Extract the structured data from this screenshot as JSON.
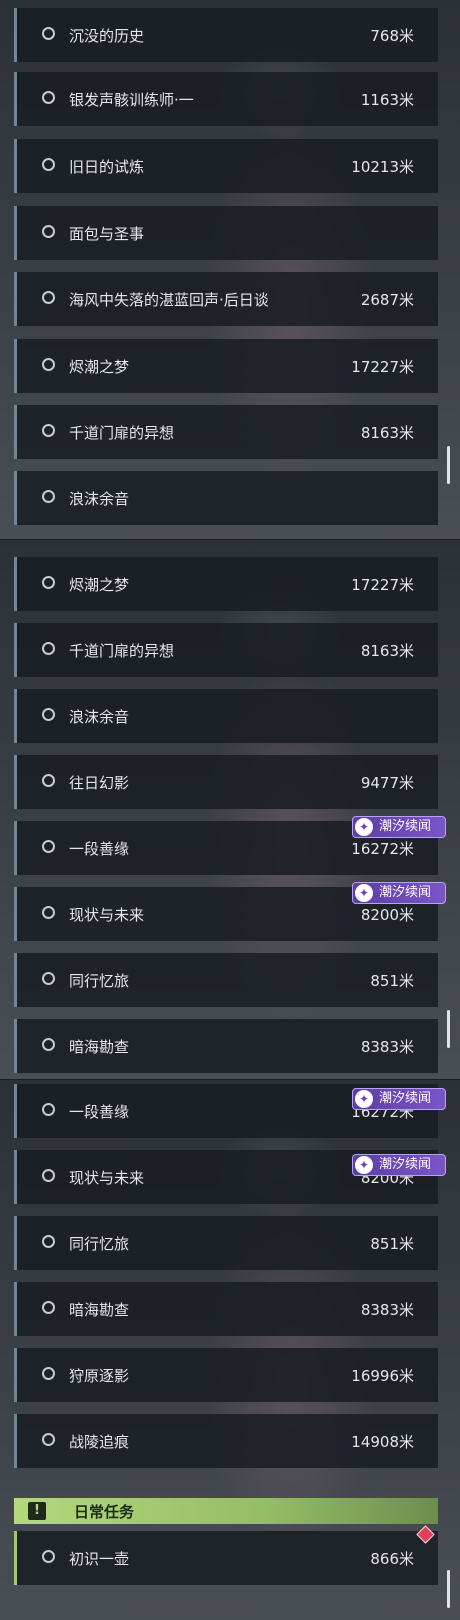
{
  "panel1": {
    "rows": [
      {
        "name": "沉没的历史",
        "distance": "768米"
      },
      {
        "name": "银发声骸训练师·一",
        "distance": "1163米"
      },
      {
        "name": "旧日的试炼",
        "distance": "10213米"
      },
      {
        "name": "面包与圣事",
        "distance": ""
      },
      {
        "name": "海风中失落的湛蓝回声·后日谈",
        "distance": "2687米"
      },
      {
        "name": "烬潮之梦",
        "distance": "17227米"
      },
      {
        "name": "千道门扉的异想",
        "distance": "8163米"
      },
      {
        "name": "浪沫余音",
        "distance": ""
      }
    ]
  },
  "panel2": {
    "rows": [
      {
        "name": "烬潮之梦",
        "distance": "17227米"
      },
      {
        "name": "千道门扉的异想",
        "distance": "8163米"
      },
      {
        "name": "浪沫余音",
        "distance": ""
      },
      {
        "name": "往日幻影",
        "distance": "9477米"
      },
      {
        "name": "一段善缘",
        "distance": "16272米",
        "badge": "潮汐续闻"
      },
      {
        "name": "现状与未来",
        "distance": "8200米",
        "badge": "潮汐续闻"
      },
      {
        "name": "同行忆旅",
        "distance": "851米"
      },
      {
        "name": "暗海勘查",
        "distance": "8383米"
      }
    ]
  },
  "panel3": {
    "rows": [
      {
        "name": "一段善缘",
        "distance": "16272米",
        "badge": "潮汐续闻"
      },
      {
        "name": "现状与未来",
        "distance": "8200米",
        "badge": "潮汐续闻"
      },
      {
        "name": "同行忆旅",
        "distance": "851米"
      },
      {
        "name": "暗海勘查",
        "distance": "8383米"
      },
      {
        "name": "狩原逐影",
        "distance": "16996米"
      },
      {
        "name": "战陵追痕",
        "distance": "14908米"
      }
    ],
    "section": {
      "title": "日常任务",
      "icon": "!"
    },
    "daily_rows": [
      {
        "name": "初识一壶",
        "distance": "866米"
      }
    ]
  },
  "icons": {
    "badge_icon": "wave-icon",
    "section_icon": "exclamation-icon",
    "marker": "diamond-marker-icon"
  },
  "colors": {
    "badge": "#6a45b8",
    "daily_accent": "#b5d87b",
    "row_bar": "#6f8796",
    "marker": "#e0405a"
  }
}
